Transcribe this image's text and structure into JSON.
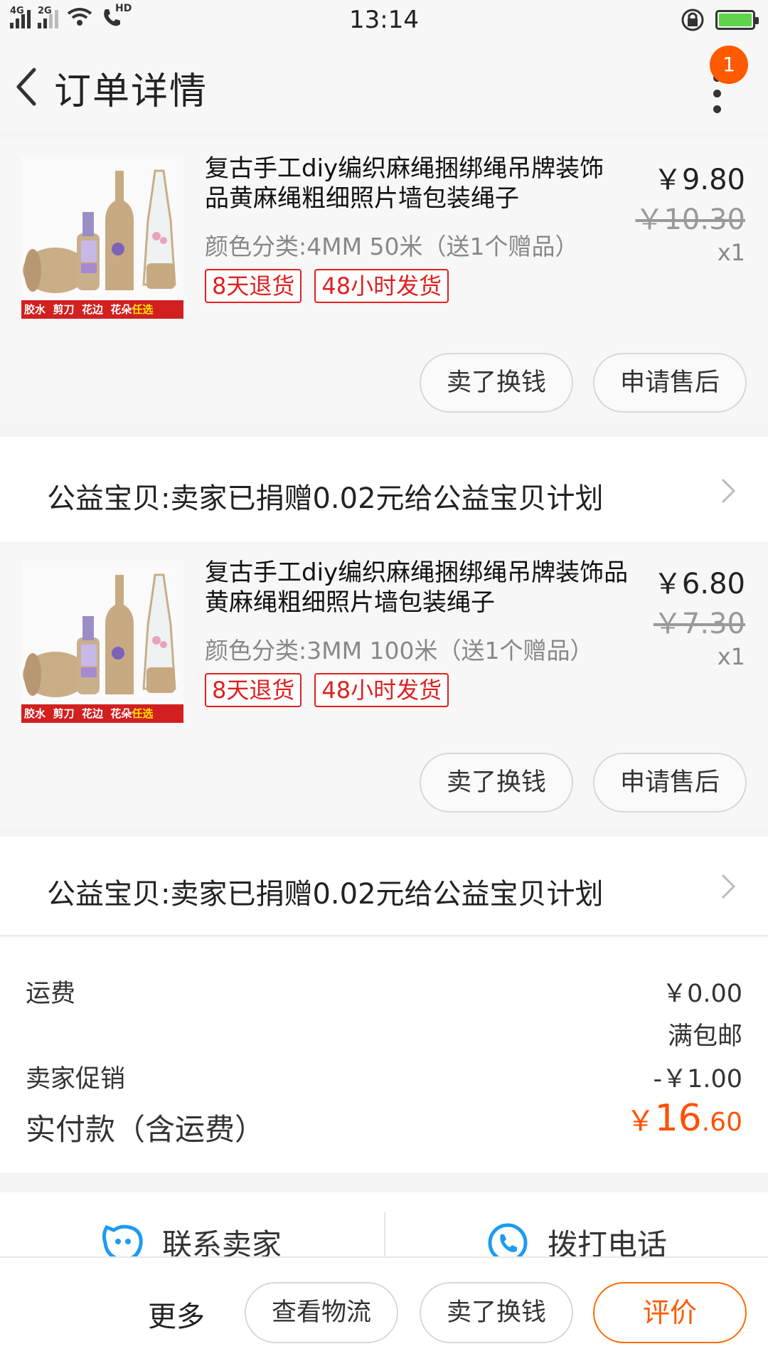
{
  "status_bar": {
    "network1": "4G",
    "network2": "2G",
    "hd": "HD",
    "time": "13:14",
    "battery_level": 1.0
  },
  "header": {
    "title": "订单详情",
    "badge_count": "1"
  },
  "items": [
    {
      "title_line1": "复古手工diy编织麻绳捆绑绳吊牌装饰",
      "title_line2": "品黄麻绳粗细照片墙包装绳子",
      "spec": "颜色分类:4MM 50米（送1个赠品）",
      "tags": [
        "8天退货",
        "48小时发货"
      ],
      "price": "￥9.80",
      "original_price": "￥10.30",
      "quantity": "x1",
      "buttons": [
        "卖了换钱",
        "申请售后"
      ],
      "thumb_strip": [
        "胶水",
        "剪刀",
        "花边",
        "花朵",
        "任选"
      ],
      "charity": "公益宝贝:卖家已捐赠0.02元给公益宝贝计划"
    },
    {
      "title_line1": "复古手工diy编织麻绳捆绑绳吊牌装饰品",
      "title_line2": "黄麻绳粗细照片墙包装绳子",
      "spec": "颜色分类:3MM 100米（送1个赠品）",
      "tags": [
        "8天退货",
        "48小时发货"
      ],
      "price": "￥6.80",
      "original_price": "￥7.30",
      "quantity": "x1",
      "buttons": [
        "卖了换钱",
        "申请售后"
      ],
      "thumb_strip": [
        "胶水",
        "剪刀",
        "花边",
        "花朵",
        "任选"
      ],
      "charity": "公益宝贝:卖家已捐赠0.02元给公益宝贝计划"
    }
  ],
  "summary": {
    "shipping_label": "运费",
    "shipping_value": "￥0.00",
    "shipping_note": "满包邮",
    "promo_label": "卖家促销",
    "promo_value": "-￥1.00",
    "total_label": "实付款（含运费）",
    "total_currency": "￥",
    "total_integer": "16",
    "total_decimal": ".60"
  },
  "contact": {
    "seller": "联系卖家",
    "phone": "拨打电话"
  },
  "bottom_bar": {
    "more": "更多",
    "logistics": "查看物流",
    "sell": "卖了换钱",
    "review": "评价"
  },
  "colors": {
    "accent": "#ff5a00",
    "tag_red": "#e02020",
    "icon_blue": "#1e9bf0"
  }
}
